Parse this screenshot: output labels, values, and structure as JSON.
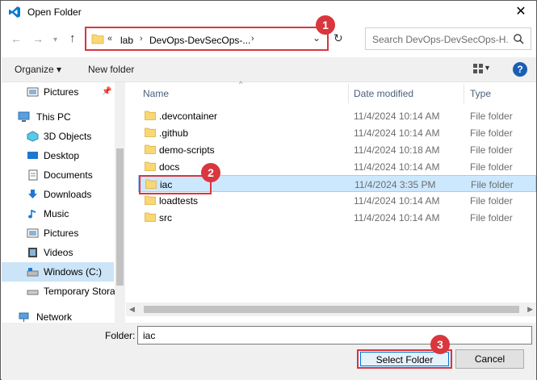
{
  "window": {
    "title": "Open Folder"
  },
  "address": {
    "crumbs": [
      "lab",
      "DevOps-DevSecOps-..."
    ],
    "overflow": "«"
  },
  "search": {
    "placeholder": "Search DevOps-DevSecOps-H..."
  },
  "toolbar": {
    "organize": "Organize ▾",
    "new_folder": "New folder"
  },
  "sidebar": {
    "items": [
      {
        "label": "Pictures",
        "icon": "pictures-icon"
      },
      {
        "label": "This PC",
        "icon": "computer-icon"
      },
      {
        "label": "3D Objects",
        "icon": "3d-objects-icon"
      },
      {
        "label": "Desktop",
        "icon": "desktop-icon"
      },
      {
        "label": "Documents",
        "icon": "documents-icon"
      },
      {
        "label": "Downloads",
        "icon": "downloads-icon"
      },
      {
        "label": "Music",
        "icon": "music-icon"
      },
      {
        "label": "Pictures",
        "icon": "pictures-icon"
      },
      {
        "label": "Videos",
        "icon": "videos-icon"
      },
      {
        "label": "Windows (C:)",
        "icon": "drive-icon"
      },
      {
        "label": "Temporary Stora",
        "icon": "drive-icon"
      },
      {
        "label": "Network",
        "icon": "network-icon"
      }
    ]
  },
  "columns": {
    "name": "Name",
    "date": "Date modified",
    "type": "Type"
  },
  "files": [
    {
      "name": ".devcontainer",
      "date": "11/4/2024 10:14 AM",
      "type": "File folder"
    },
    {
      "name": ".github",
      "date": "11/4/2024 10:14 AM",
      "type": "File folder"
    },
    {
      "name": "demo-scripts",
      "date": "11/4/2024 10:18 AM",
      "type": "File folder"
    },
    {
      "name": "docs",
      "date": "11/4/2024 10:14 AM",
      "type": "File folder"
    },
    {
      "name": "iac",
      "date": "11/4/2024 3:35 PM",
      "type": "File folder"
    },
    {
      "name": "loadtests",
      "date": "11/4/2024 10:14 AM",
      "type": "File folder"
    },
    {
      "name": "src",
      "date": "11/4/2024 10:14 AM",
      "type": "File folder"
    }
  ],
  "footer": {
    "folder_label": "Folder:",
    "folder_value": "iac",
    "select_label": "Select Folder",
    "cancel_label": "Cancel"
  },
  "annotations": {
    "one": "1",
    "two": "2",
    "three": "3"
  },
  "colors": {
    "annotation": "#d9363e",
    "selection": "#cce8ff",
    "accent": "#0078d7"
  }
}
